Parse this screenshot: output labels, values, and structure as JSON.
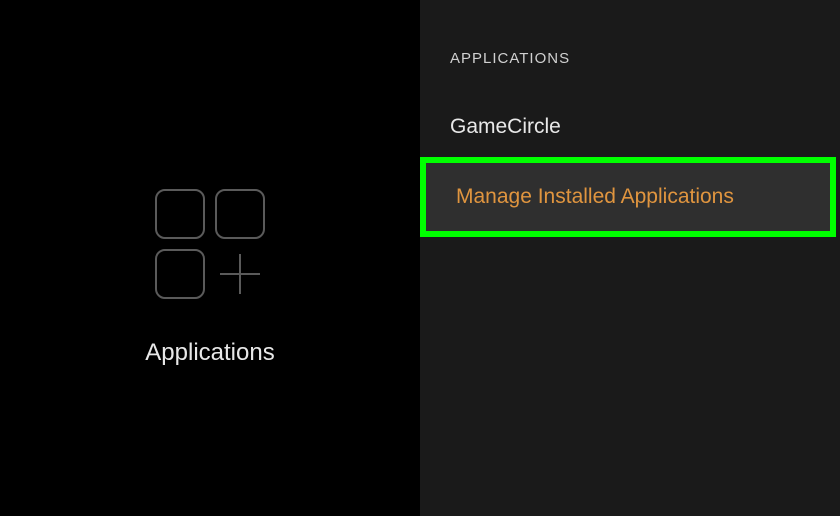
{
  "left": {
    "title": "Applications"
  },
  "right": {
    "header": "APPLICATIONS",
    "items": [
      {
        "label": "GameCircle",
        "selected": false
      },
      {
        "label": "Manage Installed Applications",
        "selected": true
      }
    ]
  }
}
